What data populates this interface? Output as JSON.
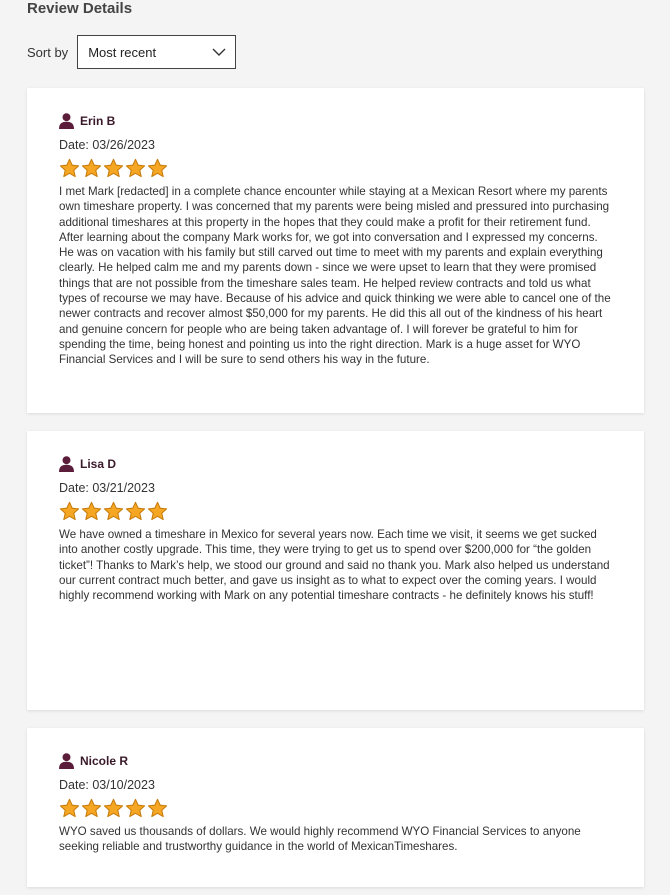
{
  "page": {
    "heading": "Review Details"
  },
  "sort": {
    "label": "Sort by",
    "selected": "Most recent"
  },
  "colors": {
    "star": "#f5a623",
    "star_outline": "#c77b0a",
    "user_icon": "#5c1d3a"
  },
  "reviews": [
    {
      "name": "Erin B",
      "date": "Date: 03/26/2023",
      "rating": 5,
      "text": "I met Mark [redacted] in a complete chance encounter while staying at a Mexican Resort where my parents own timeshare property. I was concerned that my parents were being misled and pressured into purchasing additional timeshares at this property in the hopes that they could make a profit for their retirement fund. After learning about the company Mark works for, we got into conversation and I expressed my concerns. He was on vacation with his family but still carved out time to meet with my parents and explain everything clearly. He helped calm me and my parents down - since we were upset to learn that they were promised things that are not possible from the timeshare sales team. He helped review contracts and told us what types of recourse we may have. Because of his advice and quick thinking we were able to cancel one of the newer contracts and recover almost $50,000 for my parents. He did this all out of the kindness of his heart and genuine concern for people who are being taken advantage of. I will forever be grateful to him for spending the time, being honest and pointing us into the right direction. Mark is a huge asset for WYO Financial Services and I will be sure to send others his way in the future."
    },
    {
      "name": "Lisa D",
      "date": "Date: 03/21/2023",
      "rating": 5,
      "text": "We have owned a timeshare in Mexico for several years now. Each time we visit, it seems we get sucked into another costly upgrade. This time, they were trying to get us to spend over $200,000 for “the golden ticket”! Thanks to Mark’s help, we stood our ground and said no thank you. Mark also helped us understand our current contract much better, and gave us insight as to what to expect over the coming years. I would highly recommend working with Mark on any potential timeshare contracts - he definitely knows his stuff!"
    },
    {
      "name": "Nicole R",
      "date": "Date: 03/10/2023",
      "rating": 5,
      "text": "WYO saved us thousands of dollars. We would highly recommend WYO Financial Services to anyone seeking reliable and trustworthy guidance in the world of MexicanTimeshares."
    }
  ]
}
